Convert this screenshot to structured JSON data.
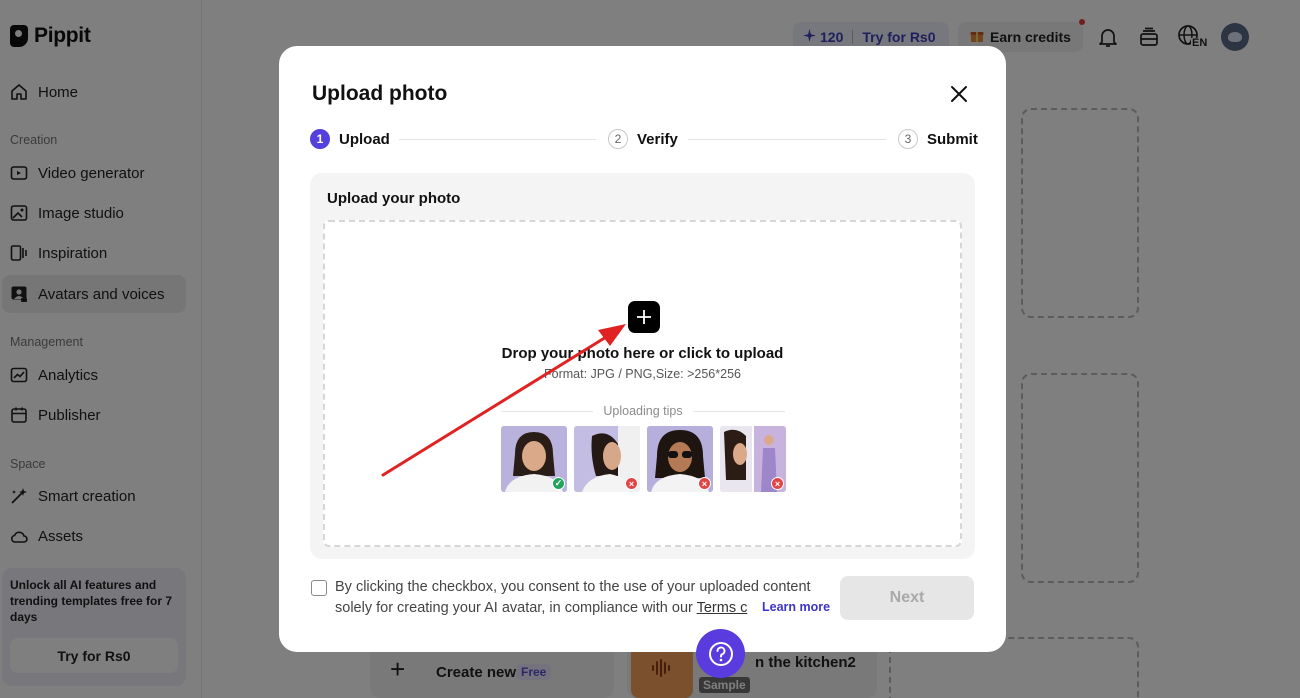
{
  "app": {
    "brand": "Pippit"
  },
  "sidebar": {
    "items": [
      {
        "label": "Home"
      },
      {
        "label": "Video generator"
      },
      {
        "label": "Image studio"
      },
      {
        "label": "Inspiration"
      },
      {
        "label": "Avatars and voices"
      },
      {
        "label": "Analytics"
      },
      {
        "label": "Publisher"
      },
      {
        "label": "Smart creation"
      },
      {
        "label": "Assets"
      }
    ],
    "sections": {
      "creation": "Creation",
      "management": "Management",
      "space": "Space"
    },
    "promo": {
      "text": "Unlock all AI features and trending templates free for 7 days",
      "button": "Try for Rs0"
    }
  },
  "topbar": {
    "credits": "120",
    "try_label": "Try for Rs0",
    "earn_label": "Earn credits",
    "language": "EN"
  },
  "background": {
    "create_new": "Create new",
    "free_badge": "Free",
    "card_title": "n the kitchen2",
    "sample_badge": "Sample"
  },
  "modal": {
    "title": "Upload photo",
    "steps": [
      {
        "num": "1",
        "label": "Upload"
      },
      {
        "num": "2",
        "label": "Verify"
      },
      {
        "num": "3",
        "label": "Submit"
      }
    ],
    "upload_heading": "Upload your photo",
    "drop_text": "Drop your photo here or click to upload",
    "format_text": "Format: JPG / PNG,Size: >256*256",
    "tips_label": "Uploading tips",
    "consent_line1": "By clicking the checkbox, you consent to the use of your uploaded content",
    "consent_line2": "solely for creating your AI avatar, in compliance with our ",
    "terms_label": "Terms c",
    "learn_more": "Learn more",
    "next_label": "Next"
  },
  "colors": {
    "accent": "#5440dc",
    "help": "#5a3bdd",
    "arrow": "#e02222"
  }
}
